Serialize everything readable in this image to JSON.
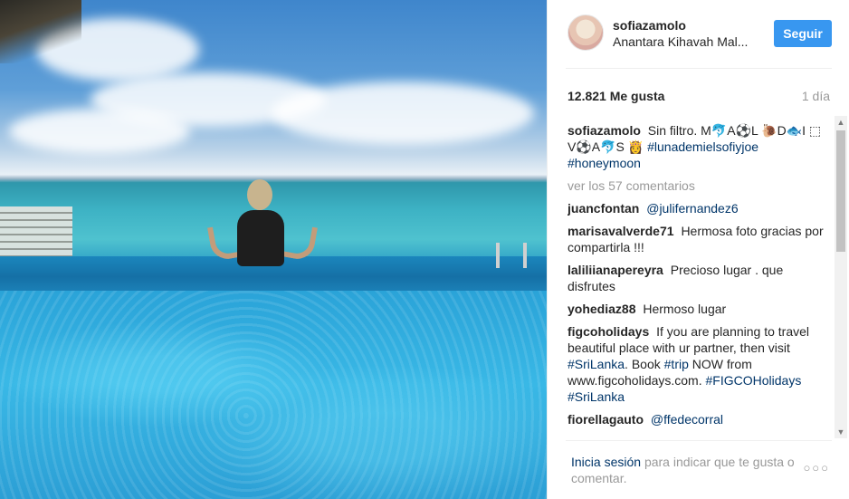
{
  "post": {
    "username": "sofiazamolo",
    "location": "Anantara Kihavah Mal...",
    "follow_label": "Seguir",
    "likes": "12.821 Me gusta",
    "age": "1 día"
  },
  "caption": {
    "username": "sofiazamolo",
    "text": "Sin filtro. M🐬A⚽L 🐌D🐟I ⬚ V⚽A🐬S 👸",
    "hashtags": [
      "#lunademielsofiyjoe",
      "#honeymoon"
    ]
  },
  "view_more": "ver los 57 comentarios",
  "comments": [
    {
      "user": "juancfontan",
      "text": "",
      "mention": "@julifernandez6"
    },
    {
      "user": "marisavalverde71",
      "text": "Hermosa foto gracias por compartirla !!!",
      "mention": ""
    },
    {
      "user": "laliliianapereyra",
      "text": "Precioso lugar . que disfrutes",
      "mention": ""
    },
    {
      "user": "yohediaz88",
      "text": "Hermoso lugar",
      "mention": ""
    },
    {
      "user": "fiorellagauto",
      "text": "",
      "mention": "@ffedecorral"
    }
  ],
  "promo_comment": {
    "user": "figcoholidays",
    "text_a": "If you are planning to travel beautiful place with ur partner, then visit",
    "tag_a": "#SriLanka",
    "text_b": ". Book",
    "tag_b": "#trip",
    "text_c": "NOW from www.figcoholidays.com.",
    "tag_c": "#FIGCOHolidays",
    "tag_d": "#SriLanka"
  },
  "footer": {
    "login_link": "Inicia sesión",
    "login_rest": "para indicar que te gusta o comentar.",
    "more_icon_glyph": "○○○"
  },
  "colors": {
    "follow_button": "#3897f0",
    "hashtag": "#003569",
    "muted": "#999999"
  },
  "icons": {
    "more_options": "ellipsis-icon",
    "scroll_up": "arrow-up-icon",
    "scroll_down": "arrow-down-icon"
  }
}
